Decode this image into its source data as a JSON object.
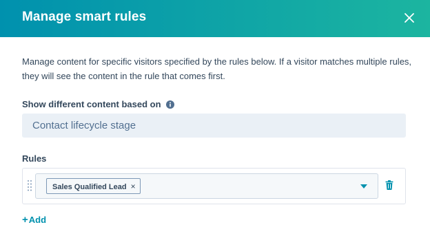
{
  "dialog": {
    "title": "Manage smart rules",
    "description": "Manage content for specific visitors specified by the rules below. If a visitor matches multiple rules, they will see the content in the rule that comes first."
  },
  "basis": {
    "label": "Show different content based on",
    "value": "Contact lifecycle stage"
  },
  "rules": {
    "label": "Rules",
    "items": [
      {
        "tag": "Sales Qualified Lead",
        "remove_glyph": "×"
      }
    ]
  },
  "add": {
    "plus": "+",
    "label": "Add"
  },
  "icons": {
    "close": "close-icon",
    "info": "info-icon",
    "drag": "drag-handle-icon",
    "caret": "caret-down-icon",
    "trash": "trash-icon"
  },
  "colors": {
    "header_start": "#0091ae",
    "header_end": "#1cb5a0",
    "link": "#0091ae",
    "text": "#33475b",
    "field_bg": "#eaf0f6"
  }
}
